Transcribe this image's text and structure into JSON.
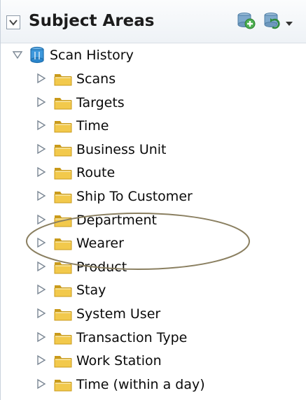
{
  "header": {
    "title": "Subject Areas",
    "icons": [
      "collapse-toggle-icon",
      "create-analysis-icon",
      "refresh-icon",
      "dropdown-arrow-icon"
    ]
  },
  "tree": {
    "root": {
      "label": "Scan History",
      "icon": "subject-area-cylinder-icon",
      "expanded": true
    },
    "items": [
      {
        "label": "Scans"
      },
      {
        "label": "Targets"
      },
      {
        "label": "Time"
      },
      {
        "label": "Business Unit"
      },
      {
        "label": "Route"
      },
      {
        "label": "Ship To Customer"
      },
      {
        "label": "Department"
      },
      {
        "label": "Wearer"
      },
      {
        "label": "Product"
      },
      {
        "label": "Stay"
      },
      {
        "label": "System User"
      },
      {
        "label": "Transaction Type"
      },
      {
        "label": "Work Station"
      },
      {
        "label": "Time (within a day)"
      }
    ]
  },
  "colors": {
    "folder": "#f2c94c",
    "folder_dark": "#c99a1a",
    "root_icon": "#2a8fd6",
    "toggle": "#7b8794",
    "highlight": "#8a7f60"
  }
}
